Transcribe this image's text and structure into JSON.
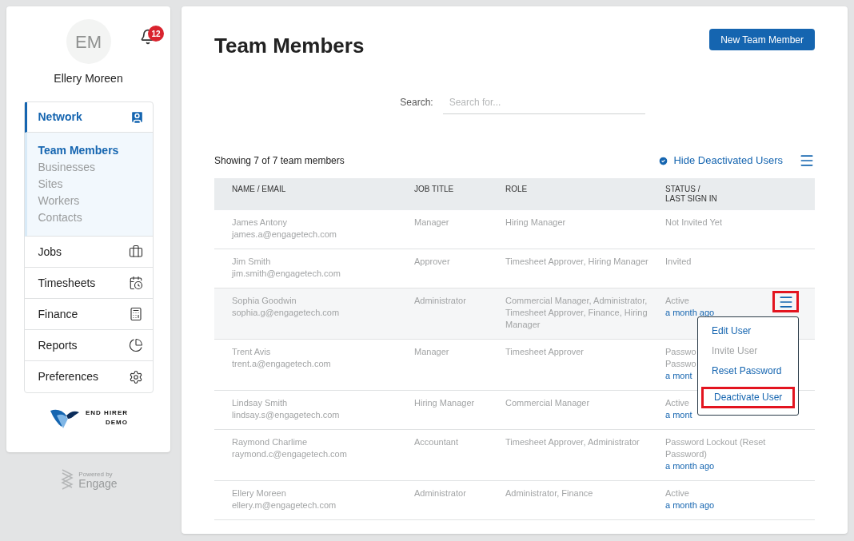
{
  "user": {
    "initials": "EM",
    "name": "Ellery Moreen",
    "notifications": "12"
  },
  "nav": {
    "section": {
      "label": "Network",
      "expanded": true,
      "children": [
        {
          "label": "Team Members",
          "selected": true
        },
        {
          "label": "Businesses",
          "selected": false
        },
        {
          "label": "Sites",
          "selected": false
        },
        {
          "label": "Workers",
          "selected": false
        },
        {
          "label": "Contacts",
          "selected": false
        }
      ]
    },
    "items": [
      {
        "label": "Jobs",
        "kind": "jobs"
      },
      {
        "label": "Timesheets",
        "kind": "timesheets"
      },
      {
        "label": "Finance",
        "kind": "finance"
      },
      {
        "label": "Reports",
        "kind": "reports"
      },
      {
        "label": "Preferences",
        "kind": "preferences"
      }
    ]
  },
  "brand": {
    "line_1": "END HIRER",
    "line_2": "DEMO"
  },
  "powered_by": {
    "caption": "Powered by",
    "name": "Engage"
  },
  "page": {
    "title": "Team Members",
    "new_button": "New Team Member",
    "search_label": "Search:",
    "search_placeholder": "Search for...",
    "count": "Showing 7 of 7 team members",
    "hide_deactivated": {
      "label": "Hide Deactivated Users",
      "checked": true
    }
  },
  "table": {
    "columns": [
      "NAME / EMAIL",
      "JOB TITLE",
      "ROLE",
      "STATUS /\nLAST SIGN IN"
    ],
    "rows": [
      {
        "name": "James Antony",
        "email": "james.a@engagetech.com",
        "job_title": "Manager",
        "role": "Hiring Manager",
        "status_lines": [
          "Not Invited Yet"
        ],
        "selected": false
      },
      {
        "name": "Jim Smith",
        "email": "jim.smith@engagetech.com",
        "job_title": "Approver",
        "role": "Timesheet Approver, Hiring Manager",
        "status_lines": [
          "Invited"
        ],
        "selected": false
      },
      {
        "name": "Sophia Goodwin",
        "email": "sophia.g@engagetech.com",
        "job_title": "Administrator",
        "role": "Commercial Manager, Administrator, Timesheet Approver, Finance, Hiring Manager",
        "status_lines": [
          "Active"
        ],
        "last_sign_in": "a month ago",
        "selected": true,
        "menu_highlighted": true
      },
      {
        "name": "Trent Avis",
        "email": "trent.a@engagetech.com",
        "job_title": "Manager",
        "role": "Timesheet Approver",
        "status_lines": [
          "Passwo",
          "Passwo"
        ],
        "last_sign_in": "a mont",
        "selected": false
      },
      {
        "name": "Lindsay Smith",
        "email": "lindsay.s@engagetech.com",
        "job_title": "Hiring Manager",
        "role": "Commercial Manager",
        "status_lines": [
          "Active"
        ],
        "last_sign_in": "a mont",
        "selected": false
      },
      {
        "name": "Raymond Charlime",
        "email": "raymond.c@engagetech.com",
        "job_title": "Accountant",
        "role": "Timesheet Approver, Administrator",
        "status_lines": [
          "Password Lockout (Reset Password)"
        ],
        "last_sign_in": "a month ago",
        "selected": false
      },
      {
        "name": "Ellery Moreen",
        "email": "ellery.m@engagetech.com",
        "job_title": "Administrator",
        "role": "Administrator, Finance",
        "status_lines": [
          "Active"
        ],
        "last_sign_in": "a month ago",
        "selected": false
      }
    ]
  },
  "row_menu": {
    "items": [
      {
        "label": "Edit User",
        "disabled": false,
        "highlighted": false
      },
      {
        "label": "Invite User",
        "disabled": true,
        "highlighted": false
      },
      {
        "label": "Reset Password",
        "disabled": false,
        "highlighted": false
      },
      {
        "label": "Deactivate User",
        "disabled": false,
        "highlighted": true
      }
    ]
  }
}
